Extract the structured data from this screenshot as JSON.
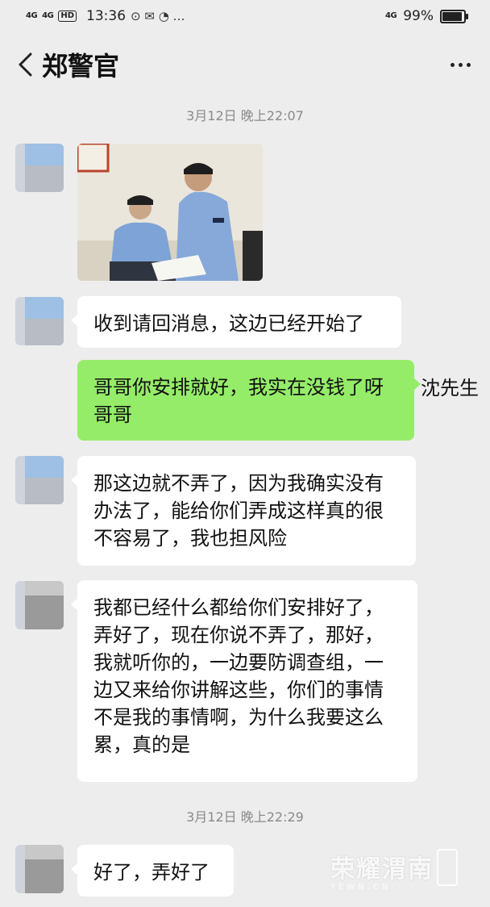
{
  "status_bar": {
    "signal1": "4G",
    "signal2": "4G",
    "hd": "HD",
    "time": "13:36",
    "icons": "⊙ ✉ ◔ …",
    "right_network": "4G",
    "battery_text": "99%",
    "battery_level": 0.99
  },
  "header": {
    "title": "郑警官",
    "back_icon": "chevron-left-icon",
    "more_icon": "more-dots-icon"
  },
  "messages": {
    "ts1": "3月12日 晚上22:07",
    "m1": "收到请回消息，这边已经开始了",
    "m2_line1": "哥哥你安排就好，我实在没钱了呀",
    "m2_line2": "哥哥",
    "m2_note": "沈先生",
    "m3_line1": "那这边就不弄了，因为我确实没有",
    "m3_line2": "办法了，能给你们弄成这样真的很",
    "m3_line3": "不容易了，我也担风险",
    "m4_line1": "我都已经什么都给你们安排好了，",
    "m4_line2": "弄好了，现在你说不弄了，那好，",
    "m4_line3": "我就听你的，一边要防调查组，一",
    "m4_line4": "边又来给你讲解这些，你们的事情",
    "m4_line5": "不是我的事情啊，为什么我要这么",
    "m4_line6": "累，真的是",
    "ts2": "3月12日 晚上22:29",
    "m5": "好了，弄好了"
  },
  "watermark": {
    "text": "荣耀渭南",
    "sub": "YEWN.CN"
  },
  "colors": {
    "background": "#ededed",
    "incoming_bubble": "#ffffff",
    "outgoing_bubble": "#95ec69"
  }
}
